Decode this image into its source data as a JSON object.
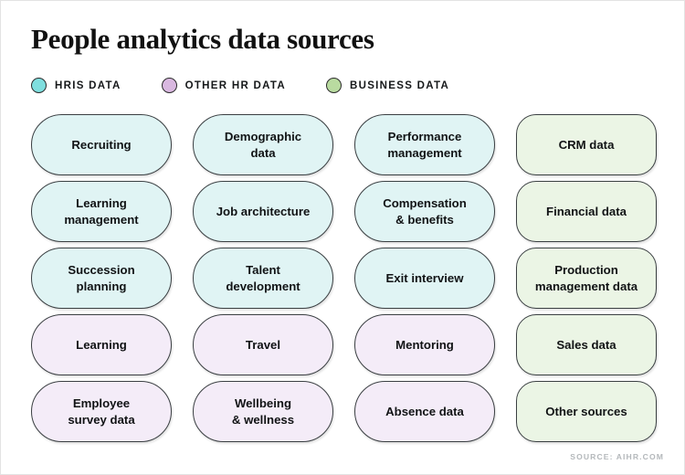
{
  "header": {
    "title": "People analytics data sources"
  },
  "legend": {
    "items": [
      {
        "label": "HRIS DATA",
        "key": "hris",
        "color": "#7fdede"
      },
      {
        "label": "OTHER HR DATA",
        "key": "otherhr",
        "color": "#d9b8e0"
      },
      {
        "label": "BUSINESS DATA",
        "key": "business",
        "color": "#b9dba0"
      }
    ]
  },
  "palette": {
    "hris_fill": "#e0f4f4",
    "otherhr_fill": "#f4ecf8",
    "business_fill": "#ebf5e5",
    "pill_border": "#3a3f42",
    "title_color": "#111111",
    "source_color": "#b4b8bb",
    "background": "#ffffff"
  },
  "grid": {
    "columns": 4,
    "rows": 5,
    "cells": [
      {
        "label": "Recruiting",
        "category": "hris"
      },
      {
        "label": "Demographic\ndata",
        "category": "hris"
      },
      {
        "label": "Performance\nmanagement",
        "category": "hris"
      },
      {
        "label": "CRM data",
        "category": "business"
      },
      {
        "label": "Learning\nmanagement",
        "category": "hris"
      },
      {
        "label": "Job architecture",
        "category": "hris"
      },
      {
        "label": "Compensation\n& benefits",
        "category": "hris"
      },
      {
        "label": "Financial data",
        "category": "business"
      },
      {
        "label": "Succession\nplanning",
        "category": "hris"
      },
      {
        "label": "Talent\ndevelopment",
        "category": "hris"
      },
      {
        "label": "Exit interview",
        "category": "hris"
      },
      {
        "label": "Production\nmanagement data",
        "category": "business"
      },
      {
        "label": "Learning",
        "category": "otherhr"
      },
      {
        "label": "Travel",
        "category": "otherhr"
      },
      {
        "label": "Mentoring",
        "category": "otherhr"
      },
      {
        "label": "Sales data",
        "category": "business"
      },
      {
        "label": "Employee\nsurvey data",
        "category": "otherhr"
      },
      {
        "label": "Wellbeing\n& wellness",
        "category": "otherhr"
      },
      {
        "label": "Absence data",
        "category": "otherhr"
      },
      {
        "label": "Other sources",
        "category": "business"
      }
    ]
  },
  "footer": {
    "source": "SOURCE: AIHR.COM"
  }
}
